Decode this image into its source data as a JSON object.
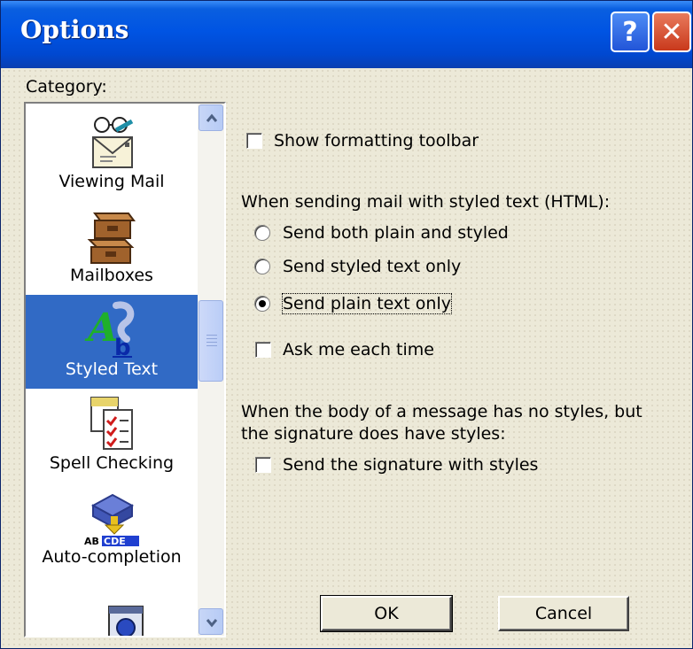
{
  "window": {
    "title": "Options",
    "help_glyph": "?",
    "close_glyph": "✕"
  },
  "category": {
    "label": "Category:",
    "items": [
      {
        "label": "Viewing Mail",
        "icon": "viewing-mail-icon",
        "selected": false
      },
      {
        "label": "Mailboxes",
        "icon": "mailboxes-icon",
        "selected": false
      },
      {
        "label": "Styled Text",
        "icon": "styled-text-icon",
        "selected": true
      },
      {
        "label": "Spell Checking",
        "icon": "spell-checking-icon",
        "selected": false
      },
      {
        "label": "Auto-completion",
        "icon": "auto-completion-icon",
        "selected": false
      }
    ]
  },
  "options": {
    "show_toolbar": {
      "label": "Show formatting toolbar",
      "checked": false
    },
    "sending_heading": "When sending mail with styled text (HTML):",
    "radios": [
      {
        "label": "Send both plain and styled",
        "selected": false
      },
      {
        "label": "Send styled text only",
        "selected": false
      },
      {
        "label": "Send plain text only",
        "selected": true
      }
    ],
    "ask_each_time": {
      "label": "Ask me each time",
      "checked": false
    },
    "signature_heading_1": "When the body of a message has no styles, but",
    "signature_heading_2": "the signature does have styles:",
    "signature_styles": {
      "label": "Send the signature with styles",
      "checked": false
    }
  },
  "buttons": {
    "ok": "OK",
    "cancel": "Cancel"
  },
  "colors": {
    "title_bar": "#0054e3",
    "selection": "#316ac5",
    "close": "#c9391c",
    "face": "#ece9d8"
  }
}
